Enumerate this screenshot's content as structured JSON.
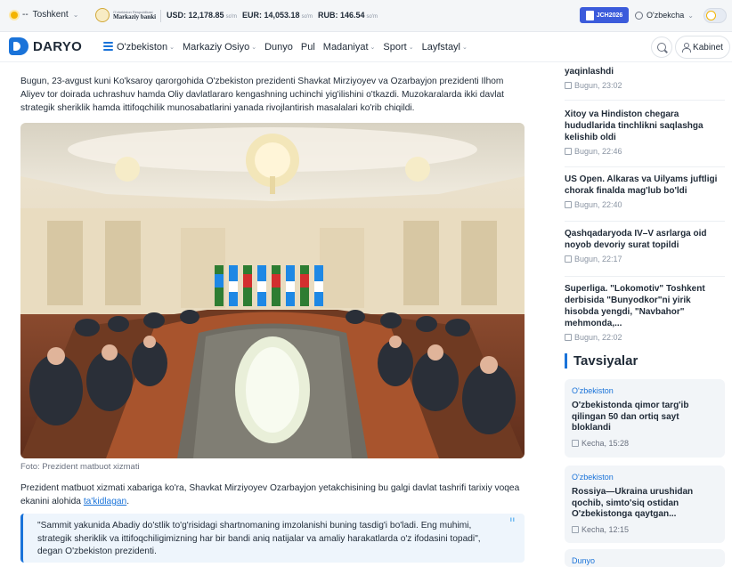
{
  "topbar": {
    "city": "Toshkent",
    "city_prefix": "--",
    "bank_line1": "O'zbekiston Respublikasi",
    "bank_line2": "Markaziy banki",
    "rates": [
      {
        "code": "USD",
        "value": "12,178.85",
        "unit": "so'm"
      },
      {
        "code": "EUR",
        "value": "14,053.18",
        "unit": "so'm"
      },
      {
        "code": "RUB",
        "value": "146.54",
        "unit": "so'm"
      }
    ],
    "promo": "JCH2026",
    "language": "O'zbekcha",
    "colors": {
      "accent": "#1a73d9",
      "promo": "#3b5bdb"
    }
  },
  "nav": {
    "logo": "DARYO",
    "menu": [
      "O'zbekiston",
      "Markaziy Osiyo",
      "Dunyo",
      "Pul",
      "Madaniyat",
      "Sport",
      "Layfstayl"
    ],
    "cabinet": "Kabinet"
  },
  "article": {
    "lead": "Bugun, 23-avgust kuni Ko'ksaroy qarorgohida O'zbekiston prezidenti Shavkat Mirziyoyev va Ozarbayjon prezidenti Ilhom Aliyev tor doirada uchrashuv hamda Oliy davlatlararo kengashning uchinchi yig'ilishini o'tkazdi. Muzokaralarda ikki davlat strategik sheriklik hamda ittifoqchilik munosabatlarini yanada rivojlantirish masalalari ko'rib chiqildi.",
    "caption": "Foto: Prezident matbuot xizmati",
    "para2_text": "Prezident matbuot xizmati xabariga ko'ra, Shavkat Mirziyoyev Ozarbayjon yetakchisining bu galgi davlat tashrifi tarixiy voqea ekanini alohida ",
    "para2_link": "ta'kidlagan",
    "para2_end": ".",
    "quote": "\"Sammit yakunida Abadiy do'stlik to'g'risidagi shartnomaning imzolanishi buning tasdig'i bo'ladi. Eng muhimi, strategik sheriklik va ittifoqchiligimizning har bir bandi aniq natijalar va amaliy harakatlarda o'z ifodasini topadi\", degan O'zbekiston prezidenti."
  },
  "sidebar": {
    "news": [
      {
        "title": "yaqinlashdi",
        "date": "Bugun, 23:02"
      },
      {
        "title": "Xitoy va Hindiston chegara hududlarida tinchlikni saqlashga kelishib oldi",
        "date": "Bugun, 22:46"
      },
      {
        "title": "US Open. Alkaras va Uilyams juftligi chorak finalda mag'lub bo'ldi",
        "date": "Bugun, 22:40"
      },
      {
        "title": "Qashqadaryoda IV–V asrlarga oid noyob devoriy surat topildi",
        "date": "Bugun, 22:17"
      },
      {
        "title": "Superliga. \"Lokomotiv\" Toshkent derbisida \"Bunyodkor\"ni yirik hisobda yengdi, \"Navbahor\" mehmonda,...",
        "date": "Bugun, 22:02"
      }
    ],
    "rec_title": "Tavsiyalar",
    "cards": [
      {
        "category": "O'zbekiston",
        "title": "O'zbekistonda qimor targ'ib qilingan 50 dan ortiq sayt bloklandi",
        "date": "Kecha, 15:28"
      },
      {
        "category": "O'zbekiston",
        "title": "Rossiya—Ukraina urushidan qochib, simto'siq ostidan O'zbekistonga qaytgan...",
        "date": "Kecha, 12:15"
      },
      {
        "category": "Dunyo"
      }
    ]
  }
}
